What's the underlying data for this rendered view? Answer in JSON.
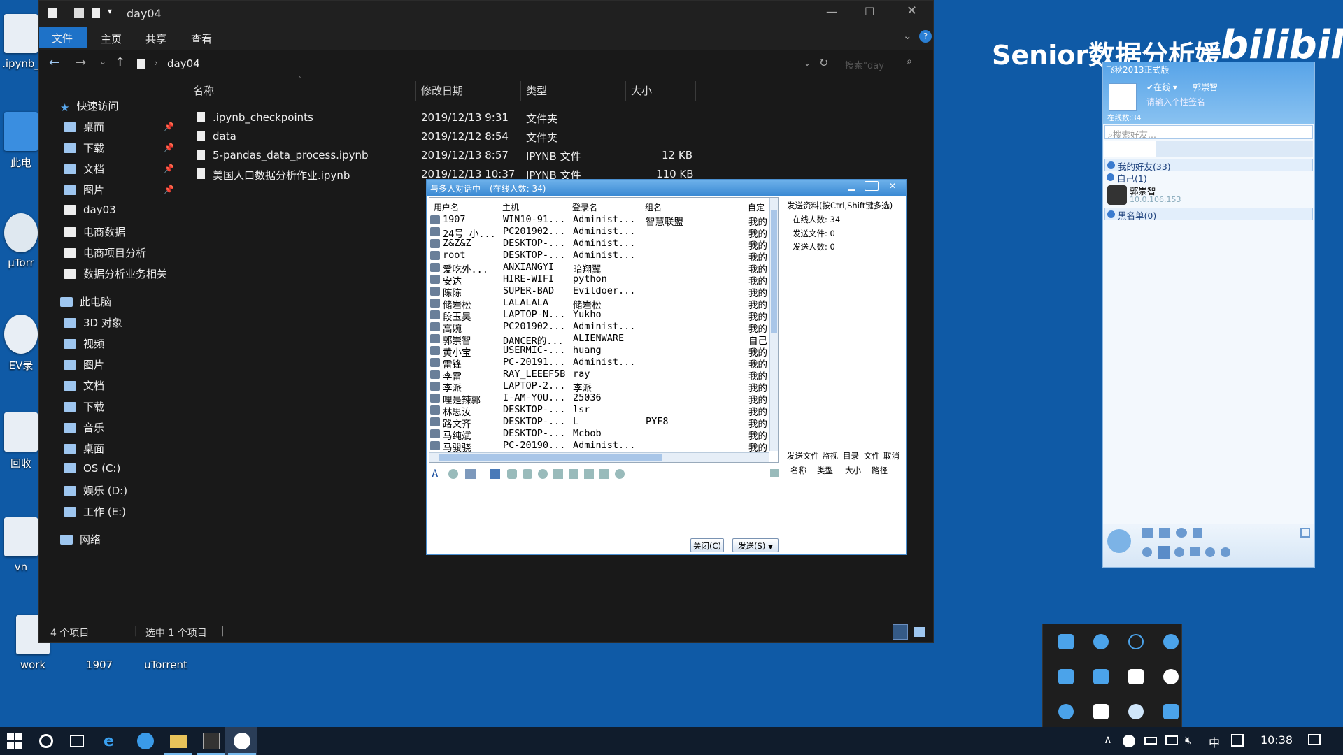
{
  "desktop": {
    "icons": [
      {
        "label": ".ipynb_"
      },
      {
        "label": "此电"
      },
      {
        "label": "µTorr"
      },
      {
        "label": "EV录"
      },
      {
        "label": "回收"
      },
      {
        "label": "vn"
      },
      {
        "label": "work"
      },
      {
        "label": "1907"
      },
      {
        "label": "uTorrent"
      }
    ]
  },
  "watermark": {
    "text": "Senior数据分析媛",
    "logo": "bilibili"
  },
  "explorer": {
    "title": "day04",
    "ribbon": [
      "文件",
      "主页",
      "共享",
      "查看"
    ],
    "path": "day04",
    "search_placeholder": "搜索\"day",
    "columns": [
      "名称",
      "修改日期",
      "类型",
      "大小"
    ],
    "quick_access_label": "快速访问",
    "quick_access": [
      "桌面",
      "下载",
      "文档",
      "图片",
      "day03",
      "电商数据",
      "电商项目分析",
      "数据分析业务相关"
    ],
    "this_pc_label": "此电脑",
    "this_pc": [
      "3D 对象",
      "视频",
      "图片",
      "文档",
      "下载",
      "音乐",
      "桌面",
      "OS (C:)",
      "娱乐 (D:)",
      "工作 (E:)"
    ],
    "network_label": "网络",
    "files": [
      {
        "name": ".ipynb_checkpoints",
        "date": "2019/12/13 9:31",
        "type": "文件夹",
        "size": ""
      },
      {
        "name": "data",
        "date": "2019/12/12 8:54",
        "type": "文件夹",
        "size": ""
      },
      {
        "name": "5-pandas_data_process.ipynb",
        "date": "2019/12/13 8:57",
        "type": "IPYNB 文件",
        "size": "12 KB"
      },
      {
        "name": "美国人口数据分析作业.ipynb",
        "date": "2019/12/13 10:37",
        "type": "IPYNB 文件",
        "size": "110 KB"
      }
    ],
    "status_count": "4 个项目",
    "status_selected": "选中 1 个项目"
  },
  "chat": {
    "title": "与多人对话中---(在线人数: 34)",
    "headers": [
      "用户名",
      "主机",
      "登录名",
      "组名",
      "自定"
    ],
    "users": [
      {
        "name": "1907",
        "host": "WIN10-91...",
        "login": "Administ...",
        "group": "智慧联盟",
        "custom": "我的"
      },
      {
        "name": "24号 小...",
        "host": "PC201902...",
        "login": "Administ...",
        "group": "",
        "custom": "我的"
      },
      {
        "name": "Z&Z&Z",
        "host": "DESKTOP-...",
        "login": "Administ...",
        "group": "",
        "custom": "我的"
      },
      {
        "name": "root",
        "host": "DESKTOP-...",
        "login": "Administ...",
        "group": "",
        "custom": "我的"
      },
      {
        "name": "爱吃外...",
        "host": "ANXIANGYI",
        "login": "暗翔翼",
        "group": "",
        "custom": "我的"
      },
      {
        "name": "安达",
        "host": "HIRE-WIFI",
        "login": "python",
        "group": "",
        "custom": "我的"
      },
      {
        "name": "陈陈",
        "host": "SUPER-BAD",
        "login": "Evildoer...",
        "group": "",
        "custom": "我的"
      },
      {
        "name": "储岩松",
        "host": "LALALALA",
        "login": "储岩松",
        "group": "",
        "custom": "我的"
      },
      {
        "name": "段玉昊",
        "host": "LAPTOP-N...",
        "login": "Yukho",
        "group": "",
        "custom": "我的"
      },
      {
        "name": "高婉",
        "host": "PC201902...",
        "login": "Administ...",
        "group": "",
        "custom": "我的"
      },
      {
        "name": "郭崇智",
        "host": "DANCER的...",
        "login": "ALIENWARE",
        "group": "",
        "custom": "自己"
      },
      {
        "name": "黄小宝",
        "host": "USERMIC-...",
        "login": "huang",
        "group": "",
        "custom": "我的"
      },
      {
        "name": "雷锋",
        "host": "PC-20191...",
        "login": "Administ...",
        "group": "",
        "custom": "我的"
      },
      {
        "name": "李雷",
        "host": "RAY_LEEEF5B",
        "login": "ray",
        "group": "",
        "custom": "我的"
      },
      {
        "name": "李派",
        "host": "LAPTOP-2...",
        "login": "李派",
        "group": "",
        "custom": "我的"
      },
      {
        "name": "哩是辣郭",
        "host": "I-AM-YOU...",
        "login": "25036",
        "group": "",
        "custom": "我的"
      },
      {
        "name": "林思汝",
        "host": "DESKTOP-...",
        "login": "lsr",
        "group": "",
        "custom": "我的"
      },
      {
        "name": "路文齐",
        "host": "DESKTOP-...",
        "login": "L",
        "group": "PYF8",
        "custom": "我的"
      },
      {
        "name": "马纯斌",
        "host": "DESKTOP-...",
        "login": "Mcbob",
        "group": "",
        "custom": "我的"
      },
      {
        "name": "马骏骁",
        "host": "PC-20190...",
        "login": "Administ...",
        "group": "",
        "custom": "我的"
      }
    ],
    "send_hint": "发送资料(按Ctrl,Shift键多选)",
    "online_count": "在线人数: 34",
    "send_files": "发送文件: 0",
    "send_people": "发送人数: 0",
    "file_tabs": [
      "发送文件",
      "监视",
      "目录",
      "文件",
      "取消"
    ],
    "file_cols": [
      "名称",
      "类型",
      "大小",
      "路径"
    ],
    "close_btn": "关闭(C)",
    "send_btn": "发送(S)"
  },
  "qq": {
    "title": "飞秋2013正式版",
    "status": "在线",
    "nickname": "郭崇智",
    "signature": "请输入个性签名",
    "online": "在线数:34",
    "search_placeholder": "搜索好友...",
    "groups": [
      "我的好友(33)",
      "自己(1)",
      "黑名单(0)"
    ],
    "self_name": "郭崇智",
    "self_ip": "10.0.106.153"
  },
  "taskbar": {
    "time": "10:38",
    "ime": "中"
  }
}
